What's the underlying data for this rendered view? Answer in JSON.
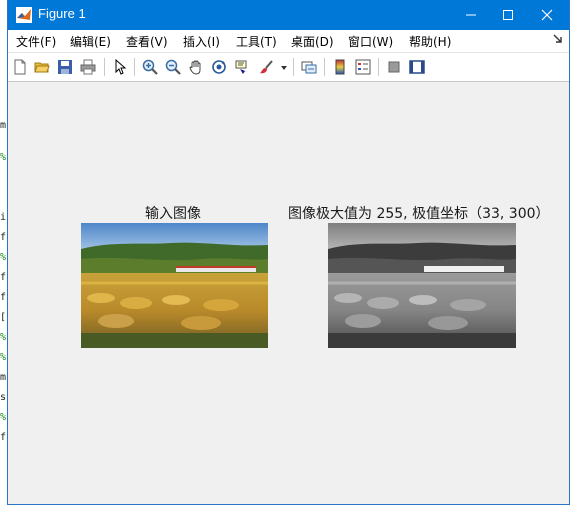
{
  "window": {
    "title": "Figure 1"
  },
  "menu": {
    "items": [
      {
        "label": "文件(F)"
      },
      {
        "label": "编辑(E)"
      },
      {
        "label": "查看(V)"
      },
      {
        "label": "插入(I)"
      },
      {
        "label": "工具(T)"
      },
      {
        "label": "桌面(D)"
      },
      {
        "label": "窗口(W)"
      },
      {
        "label": "帮助(H)"
      }
    ]
  },
  "toolbar": {
    "buttons": [
      {
        "icon": "new-file-icon"
      },
      {
        "icon": "open-folder-icon"
      },
      {
        "icon": "save-icon"
      },
      {
        "icon": "print-icon"
      },
      {
        "icon": "select-pointer-icon"
      },
      {
        "icon": "zoom-in-icon"
      },
      {
        "icon": "zoom-out-icon"
      },
      {
        "icon": "pan-hand-icon"
      },
      {
        "icon": "rotate-3d-icon"
      },
      {
        "icon": "data-cursor-icon"
      },
      {
        "icon": "brush-icon"
      },
      {
        "icon": "link-plot-icon"
      },
      {
        "icon": "colorbar-icon"
      },
      {
        "icon": "legend-icon"
      },
      {
        "icon": "hide-plot-tools-icon"
      },
      {
        "icon": "show-plot-tools-icon"
      }
    ]
  },
  "axes": {
    "left_title": "输入图像",
    "right_title": "图像极大值为 255, 极值坐标（33, 300）"
  },
  "colors": {
    "titlebar": "#0078d7",
    "canvas": "#f0f0f0",
    "menubar": "#ffffff"
  }
}
